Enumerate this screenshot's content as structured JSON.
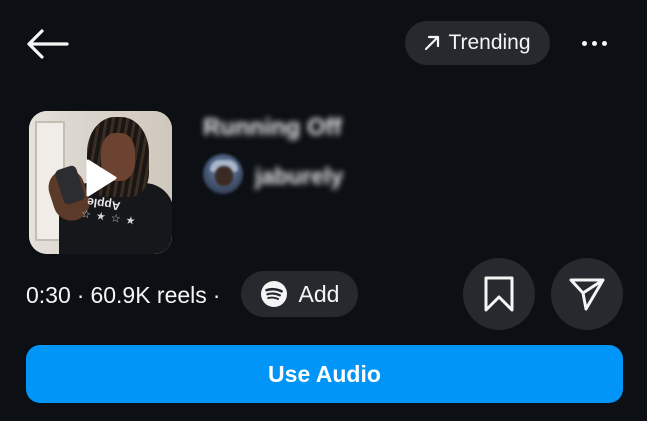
{
  "header": {
    "back_icon": "arrow-left-icon",
    "trending_icon": "arrow-up-right-icon",
    "trending_label": "Trending",
    "more_icon": "more-horizontal-icon"
  },
  "audio": {
    "title": "Running Off",
    "artist": "jaburely",
    "duration": "0:30",
    "separator": "·",
    "reels_count": "60.9K reels"
  },
  "thumbnail": {
    "play_icon": "play-icon",
    "shirt_brand": "Apple"
  },
  "actions": {
    "add_label": "Add",
    "add_icon": "spotify-icon",
    "save_icon": "bookmark-icon",
    "share_icon": "send-icon",
    "use_audio_label": "Use Audio"
  },
  "colors": {
    "background": "#0c1014",
    "pill": "#262a2f",
    "primary": "#0095f6",
    "text": "#f5f5f5"
  }
}
